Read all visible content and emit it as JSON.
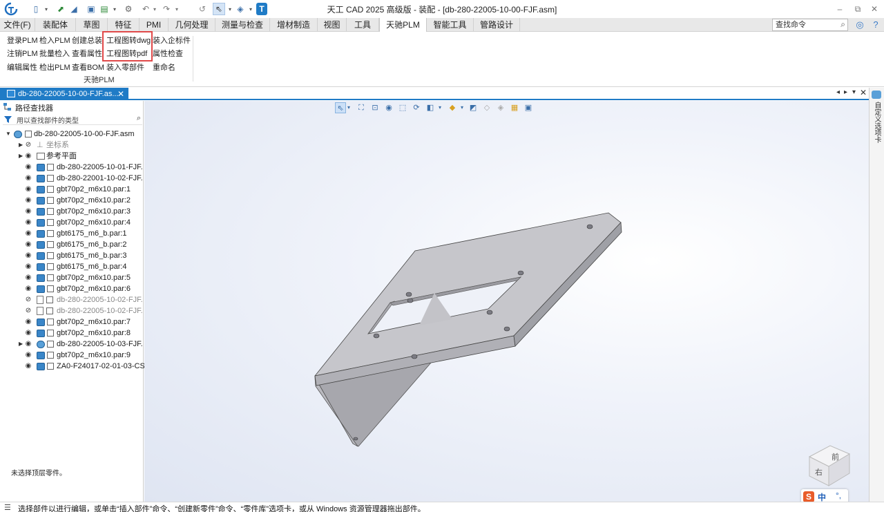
{
  "window": {
    "title": "天工 CAD 2025 高级版 - 装配 - [db-280-22005-10-00-FJF.asm]"
  },
  "tabs": [
    {
      "label": "文件(F)"
    },
    {
      "label": "装配体"
    },
    {
      "label": "草图"
    },
    {
      "label": "特征"
    },
    {
      "label": "PMI"
    },
    {
      "label": "几何处理"
    },
    {
      "label": "测量与检查"
    },
    {
      "label": "增材制造"
    },
    {
      "label": "视图"
    },
    {
      "label": "工具"
    },
    {
      "label": "天驰PLM"
    },
    {
      "label": "智能工具"
    },
    {
      "label": "管路设计"
    }
  ],
  "search_command": {
    "placeholder": "查找命令"
  },
  "ribbon": {
    "group_label": "天驰PLM",
    "buttons": [
      {
        "label": "登录PLM"
      },
      {
        "label": "检入PLM"
      },
      {
        "label": "创建总装"
      },
      {
        "label": "工程图转dwg"
      },
      {
        "label": "装入企标件"
      },
      {
        "label": "注销PLM"
      },
      {
        "label": "批量检入"
      },
      {
        "label": "查看属性"
      },
      {
        "label": "工程图转pdf"
      },
      {
        "label": "属性检查"
      },
      {
        "label": "编辑属性"
      },
      {
        "label": "检出PLM"
      },
      {
        "label": "查看BOM"
      },
      {
        "label": "装入零部件"
      },
      {
        "label": "重命名"
      }
    ]
  },
  "document_tab": {
    "label": "db-280-22005-10-00-FJF.as..."
  },
  "path_finder": {
    "title": "路径查找器",
    "filter_placeholder": "用以查找部件的类型",
    "root": "db-280-22005-10-00-FJF.asm",
    "items": [
      {
        "label": "坐标系",
        "kind": "coord",
        "dim": true
      },
      {
        "label": "参考平面",
        "kind": "plane",
        "dim": false
      },
      {
        "label": "db-280-22005-10-01-FJF.",
        "kind": "part",
        "dim": false
      },
      {
        "label": "db-280-22001-10-02-FJF.",
        "kind": "part",
        "dim": false
      },
      {
        "label": "gbt70p2_m6x10.par:1",
        "kind": "part",
        "dim": false
      },
      {
        "label": "gbt70p2_m6x10.par:2",
        "kind": "part",
        "dim": false
      },
      {
        "label": "gbt70p2_m6x10.par:3",
        "kind": "part",
        "dim": false
      },
      {
        "label": "gbt70p2_m6x10.par:4",
        "kind": "part",
        "dim": false
      },
      {
        "label": "gbt6175_m6_b.par:1",
        "kind": "part",
        "dim": false
      },
      {
        "label": "gbt6175_m6_b.par:2",
        "kind": "part",
        "dim": false
      },
      {
        "label": "gbt6175_m6_b.par:3",
        "kind": "part",
        "dim": false
      },
      {
        "label": "gbt6175_m6_b.par:4",
        "kind": "part",
        "dim": false
      },
      {
        "label": "gbt70p2_m6x10.par:5",
        "kind": "part",
        "dim": false
      },
      {
        "label": "gbt70p2_m6x10.par:6",
        "kind": "part",
        "dim": false
      },
      {
        "label": "db-280-22005-10-02-FJF.",
        "kind": "sheet",
        "dim": true
      },
      {
        "label": "db-280-22005-10-02-FJF.",
        "kind": "sheet",
        "dim": true
      },
      {
        "label": "gbt70p2_m6x10.par:7",
        "kind": "part",
        "dim": false
      },
      {
        "label": "gbt70p2_m6x10.par:8",
        "kind": "part",
        "dim": false
      },
      {
        "label": "db-280-22005-10-03-FJF.",
        "kind": "asm",
        "dim": false
      },
      {
        "label": "gbt70p2_m6x10.par:9",
        "kind": "part",
        "dim": false
      },
      {
        "label": "ZA0-F24017-02-01-03-CS",
        "kind": "part",
        "dim": false
      }
    ],
    "status": "未选择顶层零件。"
  },
  "right_sidebar": {
    "label": "自定义选项卡"
  },
  "statusbar": {
    "text": "选择部件以进行编辑，或单击“插入部件”命令、“创建新零件”命令、“零件库”选项卡，或从 Windows 资源管理器拖出部件。"
  },
  "ime": {
    "logo": "S",
    "lang": "中",
    "punct": "°,"
  },
  "view_cube": {
    "face_top": "前",
    "face_front": "右"
  }
}
